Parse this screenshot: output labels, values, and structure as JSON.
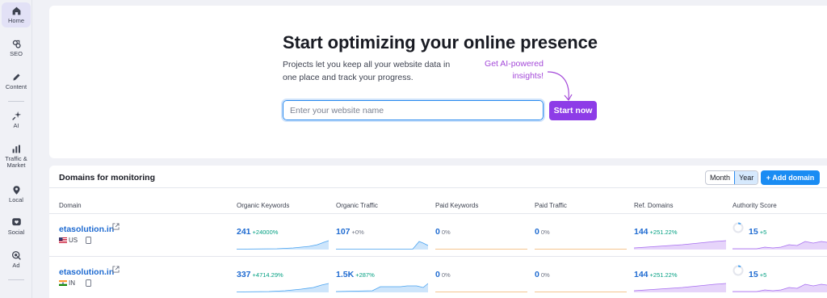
{
  "sidebar": {
    "items": [
      {
        "label": "Home",
        "icon": "home-icon"
      },
      {
        "label": "SEO",
        "icon": "seo-icon"
      },
      {
        "label": "Content",
        "icon": "pencil-icon"
      },
      {
        "label": "AI",
        "icon": "sparkle-icon"
      },
      {
        "label": "Traffic & Market",
        "icon": "bar-chart-icon"
      },
      {
        "label": "Local",
        "icon": "location-pin-icon"
      },
      {
        "label": "Social",
        "icon": "heart-icon"
      },
      {
        "label": "Ad",
        "icon": "target-icon"
      }
    ]
  },
  "hero": {
    "title": "Start optimizing your online presence",
    "description": "Projects let you keep all your website data in one place and track your progress.",
    "ai_note": "Get AI-powered insights!",
    "input_placeholder": "Enter your website name",
    "start_button": "Start now"
  },
  "domains": {
    "title": "Domains for monitoring",
    "period_toggle": [
      "Month",
      "Year"
    ],
    "selected_period": "Year",
    "add_button": "+ Add domain",
    "columns": [
      "Domain",
      "Organic Keywords",
      "Organic Traffic",
      "Paid Keywords",
      "Paid Traffic",
      "Ref. Domains",
      "Authority Score"
    ],
    "rows": [
      {
        "domain": "etasolution.in",
        "country": "US",
        "organic_keywords": "241",
        "organic_keywords_delta": "+24000%",
        "organic_traffic": "107",
        "organic_traffic_delta": "+0%",
        "paid_keywords": "0",
        "paid_keywords_delta": "0%",
        "paid_traffic": "0",
        "paid_traffic_delta": "0%",
        "ref_domains": "144",
        "ref_domains_delta": "+251.22%",
        "authority_score": "15",
        "authority_score_delta": "+5"
      },
      {
        "domain": "etasolution.in",
        "country": "IN",
        "organic_keywords": "337",
        "organic_keywords_delta": "+4714.29%",
        "organic_traffic": "1.5K",
        "organic_traffic_delta": "+287%",
        "paid_keywords": "0",
        "paid_keywords_delta": "0%",
        "paid_traffic": "0",
        "paid_traffic_delta": "0%",
        "ref_domains": "144",
        "ref_domains_delta": "+251.22%",
        "authority_score": "15",
        "authority_score_delta": "+5"
      }
    ]
  },
  "colors": {
    "accent_purple": "#8d3ce7",
    "link_blue": "#1f6bd1",
    "primary_blue": "#1a8cf3",
    "positive_green": "#009f81",
    "ai_purple": "#a449d9"
  }
}
